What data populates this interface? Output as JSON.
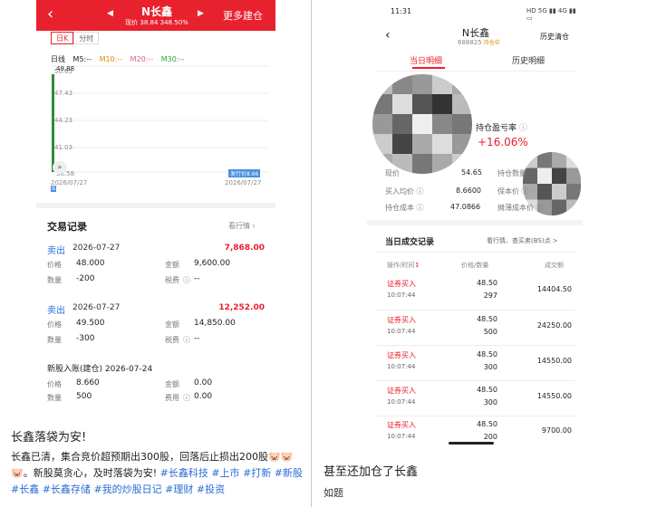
{
  "left": {
    "header": {
      "back_icon": "chevron-left-icon",
      "title": "N长鑫",
      "subtitle": "现价 38.84 348.50%",
      "more_label": "更多建仓"
    },
    "chart_tabs": [
      "日K",
      "分时"
    ],
    "ma": {
      "label": "日线",
      "m5": "M5:--",
      "m10": "M10:--",
      "m20": "M20:--",
      "m30": "M30:--",
      "colors": {
        "m5": "#222222",
        "m10": "#d98e00",
        "m20": "#e05a9a",
        "m30": "#3aa043"
      }
    },
    "chart": {
      "y_ticks": [
        "50.65",
        "49.88",
        "47.43",
        "44.23",
        "41.03",
        "38.58"
      ],
      "date_left": "2026/07/27",
      "date_right": "2026/07/27",
      "issue_badge": "发行价8.66",
      "flag": "B",
      "candle_color": "#2e8b3a"
    },
    "records": {
      "title": "交易记录",
      "link": "看行情",
      "trades": [
        {
          "type": "卖出",
          "date": "2026-07-27",
          "amount": "7,868.00",
          "price_label": "价格",
          "price": "48.000",
          "qty_label": "数量",
          "qty": "-200",
          "sum_label": "金额",
          "sum": "9,600.00",
          "tax_label": "税费",
          "tax": "--"
        },
        {
          "type": "卖出",
          "date": "2026-07-27",
          "amount": "12,252.00",
          "price_label": "价格",
          "price": "49.500",
          "qty_label": "数量",
          "qty": "-300",
          "sum_label": "金额",
          "sum": "14,850.00",
          "tax_label": "税费",
          "tax": "--"
        }
      ],
      "ipo": {
        "title": "新股入账(建仓) 2026-07-24",
        "price_label": "价格",
        "price": "8.660",
        "qty_label": "数量",
        "qty": "500",
        "sum_label": "金额",
        "sum": "0.00",
        "fee_label": "费用",
        "fee": "0.00"
      }
    },
    "post": {
      "caption": "长鑫落袋为安!",
      "body_text": "长鑫已清，集合竞价超预期出300股，回落后止损出200股",
      "emojis": "🐷🐷🐷",
      "body_text2": "。新股莫贪心，及时落袋为安!",
      "tags": [
        "#长鑫科技",
        "#上市",
        "#打新",
        "#新股",
        "#长鑫",
        "#长鑫存储",
        "#我的炒股日记",
        "#理财",
        "#投资"
      ]
    }
  },
  "right": {
    "status": {
      "time": "11:31",
      "icons": "HD 5G ▮▮ 4G ▮▮ ▭"
    },
    "header": {
      "name": "N长鑫",
      "code": "688825",
      "badge": "持仓中",
      "history": "历史清仓"
    },
    "tabs": [
      "当日明细",
      "历史明细"
    ],
    "pnl": {
      "label": "持仓盈亏率",
      "value": "+16.06%"
    },
    "stats": [
      {
        "label": "现价",
        "value": "54.65"
      },
      {
        "label": "持仓数量",
        "value": ""
      },
      {
        "label": "买入均价",
        "value": "8.6600"
      },
      {
        "label": "保本价",
        "value": ""
      },
      {
        "label": "持仓成本",
        "value": "47.0866"
      },
      {
        "label": "摊薄成本价",
        "value": ""
      }
    ],
    "deals": {
      "title": "当日成交记录",
      "link": "看行情、查买卖(BS)点 >",
      "headers": [
        "操作/时间",
        "价格/数量",
        "成交额"
      ],
      "rows": [
        {
          "type": "证券买入",
          "time": "10:07:44",
          "price": "48.50",
          "qty": "297",
          "amount": "14404.50"
        },
        {
          "type": "证券买入",
          "time": "10:07:44",
          "price": "48.50",
          "qty": "500",
          "amount": "24250.00"
        },
        {
          "type": "证券买入",
          "time": "10:07:44",
          "price": "48.50",
          "qty": "300",
          "amount": "14550.00"
        },
        {
          "type": "证券买入",
          "time": "10:07:44",
          "price": "48.50",
          "qty": "300",
          "amount": "14550.00"
        },
        {
          "type": "证券买入",
          "time": "10:07:44",
          "price": "48.50",
          "qty": "200",
          "amount": "9700.00"
        }
      ]
    },
    "caption": "甚至还加仓了长鑫",
    "sub": "如题"
  }
}
